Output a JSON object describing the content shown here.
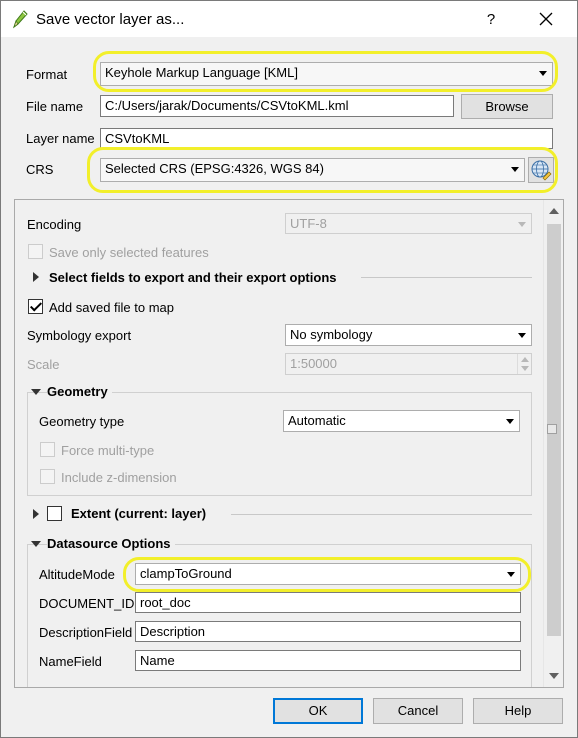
{
  "window": {
    "title": "Save vector layer as...",
    "help_glyph": "?",
    "close_glyph": "✕"
  },
  "form": {
    "format_label": "Format",
    "format_value": "Keyhole Markup Language [KML]",
    "file_name_label": "File name",
    "file_name_value": "C:/Users/jarak/Documents/CSVtoKML.kml",
    "browse_label": "Browse",
    "layer_name_label": "Layer name",
    "layer_name_value": "CSVtoKML",
    "crs_label": "CRS",
    "crs_value": "Selected CRS (EPSG:4326, WGS 84)"
  },
  "options": {
    "encoding_label": "Encoding",
    "encoding_value": "UTF-8",
    "save_selected_label": "Save only selected features",
    "select_fields_label": "Select fields to export and their export options",
    "add_to_map_label": "Add saved file to map",
    "add_to_map_checked": true,
    "symbology_label": "Symbology export",
    "symbology_value": "No symbology",
    "scale_label": "Scale",
    "scale_value": "1:50000"
  },
  "geometry": {
    "title": "Geometry",
    "type_label": "Geometry type",
    "type_value": "Automatic",
    "force_multi_label": "Force multi-type",
    "include_z_label": "Include z-dimension"
  },
  "extent": {
    "title": "Extent (current: layer)"
  },
  "datasource": {
    "title": "Datasource Options",
    "altitude_mode_label": "AltitudeMode",
    "altitude_mode_value": "clampToGround",
    "document_id_label": "DOCUMENT_ID",
    "document_id_value": "root_doc",
    "description_field_label": "DescriptionField",
    "description_field_value": "Description",
    "name_field_label": "NameField",
    "name_field_value": "Name"
  },
  "buttons": {
    "ok": "OK",
    "cancel": "Cancel",
    "help": "Help"
  },
  "colors": {
    "highlight": "#f2ef2a",
    "default_button_border": "#0078d7",
    "dialog_background": "#f0f0f0"
  },
  "icons": {
    "title": "qgis-pencil-icon",
    "crs": "globe-crs-icon"
  }
}
